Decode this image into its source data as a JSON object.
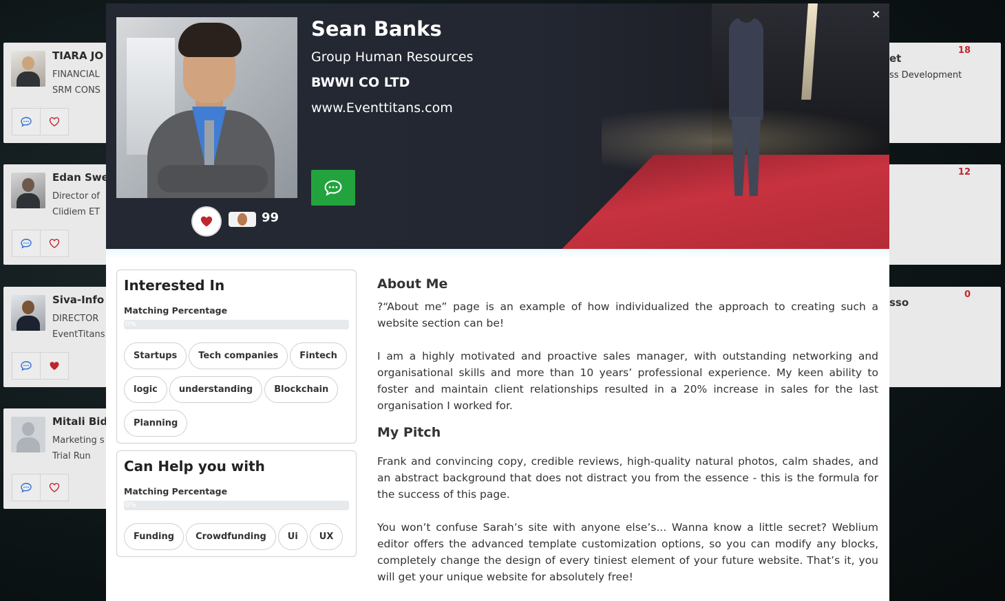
{
  "background_cards": {
    "left": [
      {
        "name": "TIARA JO",
        "line1": "FINANCIAL",
        "line2": "SRM CONS",
        "liked": false
      },
      {
        "name": "Edan Swe",
        "line1": "Director of",
        "line2": "Clidiem ET",
        "liked": false
      },
      {
        "name": "Siva-Info",
        "line1": "DIRECTOR",
        "line2": "EventTitans",
        "liked": true
      },
      {
        "name": "Mitali Bid",
        "line1": "Marketing s",
        "line2": "Trial Run",
        "liked": false
      }
    ],
    "right": [
      {
        "count": "18",
        "line1": "et",
        "line2": "ss Development"
      },
      {
        "count": "12",
        "line1": "",
        "line2": ""
      },
      {
        "count": "0",
        "line1": "sso",
        "line2": ""
      }
    ]
  },
  "profile": {
    "name": "Sean Banks",
    "title": "Group Human Resources",
    "company": "BWWI CO LTD",
    "website": "www.Eventtitans.com",
    "likes": "99",
    "close_label": "×"
  },
  "interested_in": {
    "heading": "Interested In",
    "matching_label": "Matching Percentage",
    "matching_value": "0%",
    "matching_fraction": 0,
    "tags": [
      "Startups",
      "Tech companies",
      "Fintech",
      "logic",
      "understanding",
      "Blockchain",
      "Planning"
    ]
  },
  "can_help": {
    "heading": "Can Help you with",
    "matching_label": "Matching Percentage",
    "matching_value": "0%",
    "matching_fraction": 0,
    "tags": [
      "Funding",
      "Crowdfunding",
      "Ui",
      "UX"
    ]
  },
  "about": {
    "heading": "About Me",
    "p1": "?“About me” page is an example of how individualized the approach to creating such a website section can be!",
    "p2": "I am a highly motivated and proactive sales manager, with outstanding networking and organisational skills and more than 10 years’ professional experience. My keen ability to foster and maintain client relationships resulted in a 20% increase in sales for the last organisation I worked for."
  },
  "pitch": {
    "heading": "My Pitch",
    "p1": "Frank and convincing copy, credible reviews, high-quality natural photos, calm shades, and an abstract background that does not distract you from the essence - this is the formula for the success of this page.",
    "p2": "You won’t confuse Sarah’s site with anyone else’s... Wanna know a little secret? Weblium editor offers the advanced template customization options, so you can modify any blocks, completely change the design of every tiniest element of your future website. That’s it, you will get your unique website for absolutely free!"
  },
  "colors": {
    "accent_green": "#22a33d",
    "heart_red": "#c0262d",
    "chat_blue": "#2a6fd6"
  },
  "icons": [
    "chat-icon",
    "heart-icon",
    "close-icon"
  ]
}
